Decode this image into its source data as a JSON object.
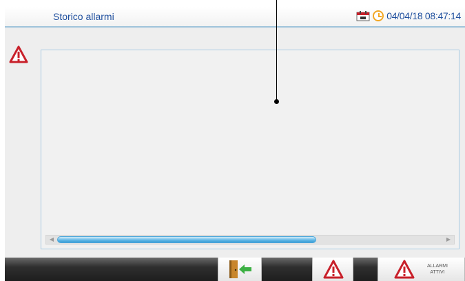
{
  "header": {
    "title": "Storico allarmi",
    "datetime": "04/04/18 08:47:14",
    "calendar_icon": "calendar-icon",
    "clock_icon": "clock-icon"
  },
  "icons": {
    "alarm": "warning-triangle-icon",
    "exit": "exit-door-icon"
  },
  "toolbar": {
    "active_alarms_label_line1": "ALLARMI",
    "active_alarms_label_line2": "ATTIVI"
  },
  "colors": {
    "title_blue": "#1f4f9e",
    "alarm_red": "#c8202a",
    "clock_orange": "#f2a623",
    "scroll_blue": "#5db6e6",
    "exit_green": "#3cb043"
  }
}
